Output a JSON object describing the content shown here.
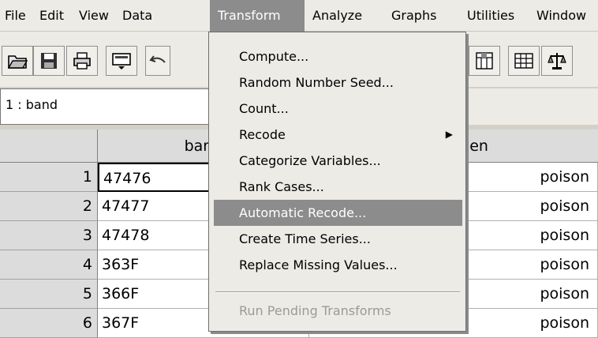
{
  "menubar": {
    "items": [
      "File",
      "Edit",
      "View",
      "Data",
      "Transform",
      "Analyze",
      "Graphs",
      "Utilities",
      "Window"
    ],
    "active": "Transform"
  },
  "toolbar": {
    "buttons": [
      "open-folder-icon",
      "save-disk-icon",
      "print-icon",
      "dialog-recall-icon",
      "undo-icon",
      "variables-icon",
      "value-labels-icon",
      "weight-cases-icon"
    ]
  },
  "cell_ref": {
    "text": "1 : band"
  },
  "grid": {
    "columns": [
      "band",
      "treatmen"
    ],
    "rows": [
      {
        "num": "1",
        "band": "47476",
        "treatmen": "poison"
      },
      {
        "num": "2",
        "band": "47477",
        "treatmen": "poison"
      },
      {
        "num": "3",
        "band": "47478",
        "treatmen": "poison"
      },
      {
        "num": "4",
        "band": "363F",
        "treatmen": "poison"
      },
      {
        "num": "5",
        "band": "366F",
        "treatmen": "poison"
      },
      {
        "num": "6",
        "band": "367F",
        "treatmen": "poison"
      }
    ]
  },
  "transform_menu": {
    "items": [
      {
        "label": "Compute..."
      },
      {
        "label": "Random Number Seed..."
      },
      {
        "label": "Count..."
      },
      {
        "label": "Recode",
        "submenu": true
      },
      {
        "label": "Categorize Variables..."
      },
      {
        "label": "Rank Cases..."
      },
      {
        "label": "Automatic Recode...",
        "highlighted": true
      },
      {
        "label": "Create Time Series..."
      },
      {
        "label": "Replace Missing Values..."
      },
      {
        "label": "Run Pending Transforms",
        "disabled": true
      }
    ]
  }
}
